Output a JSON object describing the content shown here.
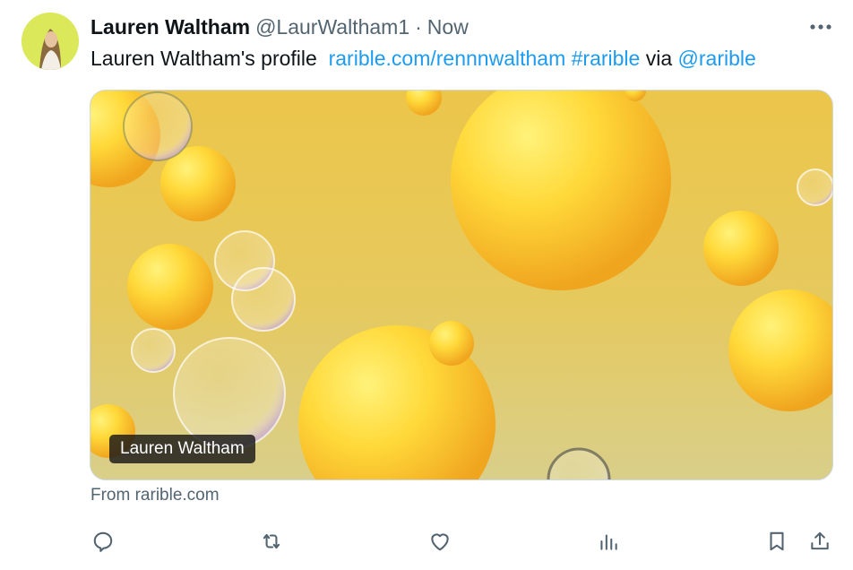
{
  "author": {
    "name": "Lauren Waltham",
    "handle": "@LaurWaltham1",
    "separator": "·",
    "time": "Now"
  },
  "tweet": {
    "text": "Lauren Waltham's profile",
    "link": "rarible.com/rennnwaltham",
    "hashtag": "#rarible",
    "via": "via",
    "mention": "@rarible"
  },
  "card": {
    "label": "Lauren Waltham",
    "source": "From rarible.com"
  },
  "icons": {
    "more": "more-options-icon",
    "reply": "reply-icon",
    "retweet": "retweet-icon",
    "like": "heart-icon",
    "views": "analytics-icon",
    "bookmark": "bookmark-icon",
    "share": "share-icon"
  },
  "colors": {
    "link": "#1d9bf0",
    "secondary_text": "#536471",
    "card_background": "#ecc64a",
    "avatar_background": "#dbe85a"
  }
}
